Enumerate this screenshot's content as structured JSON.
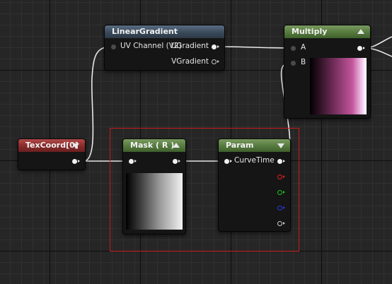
{
  "nodes": {
    "linear_gradient": {
      "title": "LinearGradient",
      "input_uv": "UV Channel (V2)",
      "output_u": "UGradient",
      "output_v": "VGradient"
    },
    "multiply": {
      "title": "Multiply",
      "input_a": "A",
      "input_b": "B"
    },
    "texcoord": {
      "title": "TexCoord[0]"
    },
    "mask": {
      "title": "Mask ( R )"
    },
    "param": {
      "title": "Param",
      "output_curve": "CurveTime"
    }
  },
  "colors": {
    "canvas_bg": "#262626",
    "selection": "#c91a1a",
    "header_function": "#3a4a5b",
    "header_math": "#557a3e",
    "header_coord": "#862b2b",
    "wire": "#e8e8e8",
    "pin_red": "#e02020",
    "pin_green": "#22c022",
    "pin_blue": "#2a3adf"
  },
  "icons": {
    "collapse": "triangle-up",
    "expand": "triangle-down",
    "pin": "circle-with-arrow"
  }
}
